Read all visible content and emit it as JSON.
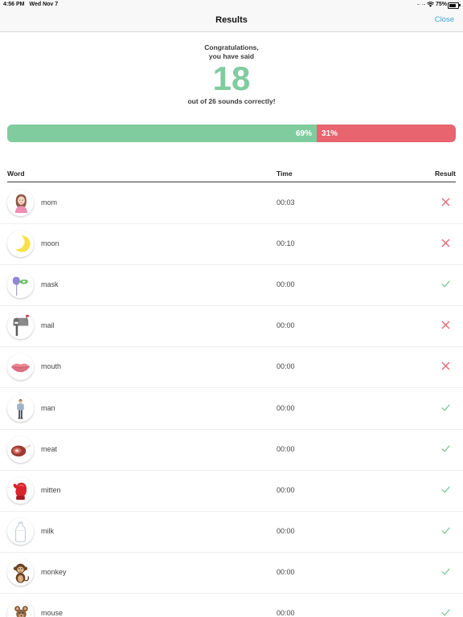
{
  "status_bar": {
    "time": "4:56 PM",
    "date": "Wed Nov 7",
    "battery_percent": "75%",
    "battery_level": 0.75,
    "icons": {
      "signal": "cellular-dots-icon",
      "wifi": "wifi-icon",
      "battery": "battery-icon"
    }
  },
  "nav_bar": {
    "title": "Results",
    "close_label": "Close"
  },
  "summary": {
    "line1": "Congratulations,",
    "line2": "you have said",
    "correct_count": "18",
    "line3": "out of 26 sounds correctly!"
  },
  "progress": {
    "correct_percent": 69,
    "incorrect_percent": 31,
    "correct_label": "69%",
    "incorrect_label": "31%"
  },
  "table": {
    "headers": {
      "word": "Word",
      "time": "Time",
      "result": "Result"
    },
    "rows": [
      {
        "image": "mom-image",
        "word": "mom",
        "time": "00:03",
        "result_icon": "cross-icon"
      },
      {
        "image": "moon-image",
        "word": "moon",
        "time": "00:10",
        "result_icon": "cross-icon"
      },
      {
        "image": "mask-image",
        "word": "mask",
        "time": "00:00",
        "result_icon": "check-icon"
      },
      {
        "image": "mail-image",
        "word": "mail",
        "time": "00:00",
        "result_icon": "cross-icon"
      },
      {
        "image": "mouth-image",
        "word": "mouth",
        "time": "00:00",
        "result_icon": "cross-icon"
      },
      {
        "image": "man-image",
        "word": "man",
        "time": "00:00",
        "result_icon": "check-icon"
      },
      {
        "image": "meat-image",
        "word": "meat",
        "time": "00:00",
        "result_icon": "check-icon"
      },
      {
        "image": "mitten-image",
        "word": "mitten",
        "time": "00:00",
        "result_icon": "check-icon"
      },
      {
        "image": "milk-image",
        "word": "milk",
        "time": "00:00",
        "result_icon": "check-icon"
      },
      {
        "image": "monkey-image",
        "word": "monkey",
        "time": "00:00",
        "result_icon": "check-icon"
      },
      {
        "image": "mouse-image",
        "word": "mouse",
        "time": "00:00",
        "result_icon": "check-icon"
      }
    ]
  },
  "colors": {
    "accent": "#42a5d8",
    "correct": "#80cc9e",
    "incorrect": "#e8646e"
  }
}
